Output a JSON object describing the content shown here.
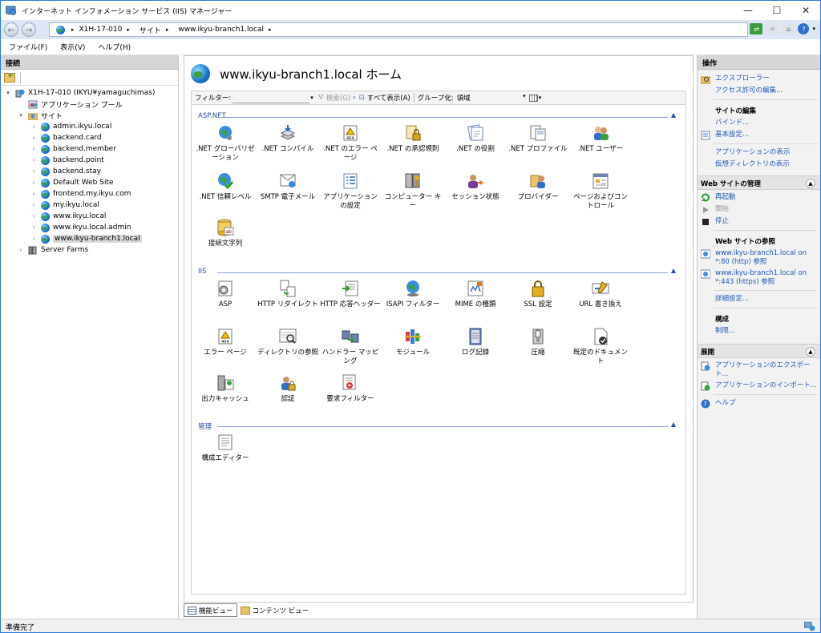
{
  "window": {
    "title": "インターネット インフォメーション サービス (IIS) マネージャー",
    "min": "—",
    "max": "☐",
    "close": "✕"
  },
  "address": {
    "crumbs": [
      "X1H-17-010",
      "サイト",
      "www.ikyu-branch1.local"
    ]
  },
  "menu": [
    "ファイル(F)",
    "表示(V)",
    "ヘルプ(H)"
  ],
  "left": {
    "header": "接続",
    "tree": [
      {
        "label": "X1H-17-010 (IKYU¥yamaguchimas)",
        "level": 0,
        "toggle": "▾",
        "icon": "server-icon"
      },
      {
        "label": "アプリケーション プール",
        "level": 1,
        "toggle": "",
        "icon": "app-pool-icon"
      },
      {
        "label": "サイト",
        "level": 1,
        "toggle": "▾",
        "icon": "sites-folder-icon"
      },
      {
        "label": "admin.ikyu.local",
        "level": 2,
        "toggle": "›",
        "icon": "globe-icon"
      },
      {
        "label": "backend.card",
        "level": 2,
        "toggle": "›",
        "icon": "globe-icon"
      },
      {
        "label": "backend.member",
        "level": 2,
        "toggle": "›",
        "icon": "globe-icon"
      },
      {
        "label": "backend.point",
        "level": 2,
        "toggle": "›",
        "icon": "globe-icon"
      },
      {
        "label": "backend.stay",
        "level": 2,
        "toggle": "›",
        "icon": "globe-icon"
      },
      {
        "label": "Default Web Site",
        "level": 2,
        "toggle": "›",
        "icon": "globe-icon"
      },
      {
        "label": "frontend.my.ikyu.com",
        "level": 2,
        "toggle": "›",
        "icon": "globe-icon"
      },
      {
        "label": "my.ikyu.local",
        "level": 2,
        "toggle": "›",
        "icon": "globe-icon"
      },
      {
        "label": "www.ikyu.local",
        "level": 2,
        "toggle": "›",
        "icon": "globe-icon"
      },
      {
        "label": "www.ikyu.local.admin",
        "level": 2,
        "toggle": "›",
        "icon": "globe-icon"
      },
      {
        "label": "www.ikyu-branch1.local",
        "level": 2,
        "toggle": "›",
        "icon": "globe-icon",
        "selected": true
      },
      {
        "label": "Server Farms",
        "level": 1,
        "toggle": "›",
        "icon": "server-farms-icon"
      }
    ]
  },
  "center": {
    "title": "www.ikyu-branch1.local ホーム",
    "filter": {
      "label": "フィルター:",
      "search": "検索(G)",
      "show_all": "すべて表示(A)",
      "group_label": "グループ化:",
      "group_value": "領域"
    },
    "sections": [
      {
        "name": "ASP.NET",
        "items": [
          {
            "label": ".NET グローバリゼーション",
            "icon": "globe-gear-icon"
          },
          {
            "label": ".NET コンパイル",
            "icon": "compile-icon"
          },
          {
            "label": ".NET のエラー ページ",
            "icon": "error-page-icon"
          },
          {
            "label": ".NET の承認規則",
            "icon": "authorization-lock-icon"
          },
          {
            "label": ".NET の役割",
            "icon": "roles-icon"
          },
          {
            "label": ".NET プロファイル",
            "icon": "profile-icon"
          },
          {
            "label": ".NET ユーザー",
            "icon": "users-icon"
          },
          {
            "label": ".NET 信頼レベル",
            "icon": "trust-level-icon"
          },
          {
            "label": "SMTP 電子メール",
            "icon": "smtp-mail-icon"
          },
          {
            "label": "アプリケーションの設定",
            "icon": "app-settings-icon"
          },
          {
            "label": "コンピューター キー",
            "icon": "machine-key-icon"
          },
          {
            "label": "セッション状態",
            "icon": "session-state-icon"
          },
          {
            "label": "プロバイダー",
            "icon": "providers-icon"
          },
          {
            "label": "ページおよびコントロール",
            "icon": "pages-controls-icon"
          },
          {
            "label": "接続文字列",
            "icon": "connection-strings-icon"
          }
        ]
      },
      {
        "name": "IIS",
        "items": [
          {
            "label": "ASP",
            "icon": "asp-icon"
          },
          {
            "label": "HTTP リダイレクト",
            "icon": "http-redirect-icon"
          },
          {
            "label": "HTTP 応答ヘッダー",
            "icon": "response-headers-icon"
          },
          {
            "label": "ISAPI フィルター",
            "icon": "isapi-filter-icon"
          },
          {
            "label": "MIME の種類",
            "icon": "mime-types-icon"
          },
          {
            "label": "SSL 設定",
            "icon": "ssl-lock-icon"
          },
          {
            "label": "URL 書き換え",
            "icon": "url-rewrite-icon"
          },
          {
            "label": "エラー ページ",
            "icon": "error-pages-icon"
          },
          {
            "label": "ディレクトリの参照",
            "icon": "directory-browsing-icon"
          },
          {
            "label": "ハンドラー マッピング",
            "icon": "handler-mappings-icon"
          },
          {
            "label": "モジュール",
            "icon": "modules-icon"
          },
          {
            "label": "ログ記録",
            "icon": "logging-icon"
          },
          {
            "label": "圧縮",
            "icon": "compression-icon"
          },
          {
            "label": "既定のドキュメント",
            "icon": "default-document-icon"
          },
          {
            "label": "出力キャッシュ",
            "icon": "output-cache-icon"
          },
          {
            "label": "認証",
            "icon": "authentication-icon"
          },
          {
            "label": "要求フィルター",
            "icon": "request-filtering-icon"
          }
        ]
      },
      {
        "name": "管理",
        "items": [
          {
            "label": "構成エディター",
            "icon": "configuration-editor-icon"
          }
        ]
      }
    ]
  },
  "right": {
    "header": "操作",
    "top_actions": [
      {
        "label": "エクスプローラー",
        "icon": "explore-icon"
      },
      {
        "label": "アクセス許可の編集...",
        "icon": ""
      }
    ],
    "edit_site": {
      "heading": "サイトの編集",
      "actions": [
        {
          "label": "バインド...",
          "icon": ""
        },
        {
          "label": "基本設定...",
          "icon": "basic-settings-icon"
        },
        {
          "label": "アプリケーションの表示",
          "icon": ""
        },
        {
          "label": "仮想ディレクトリの表示",
          "icon": ""
        }
      ]
    },
    "manage": {
      "header": "Web サイトの管理",
      "actions": [
        {
          "label": "再起動",
          "icon": "restart-icon",
          "disabled": false
        },
        {
          "label": "開始",
          "icon": "start-icon",
          "disabled": true
        },
        {
          "label": "停止",
          "icon": "stop-icon",
          "disabled": false
        }
      ]
    },
    "browse": {
      "heading": "Web サイトの参照",
      "actions": [
        {
          "label": "www.ikyu-branch1.local on *:80 (http) 参照",
          "icon": "browse-icon"
        },
        {
          "label": "www.ikyu-branch1.local on *:443 (https) 参照",
          "icon": "browse-icon"
        }
      ],
      "advanced": "詳細設定..."
    },
    "config": {
      "heading": "構成",
      "limits": "制限..."
    },
    "deploy": {
      "header": "展開",
      "actions": [
        {
          "label": "アプリケーションのエクスポート...",
          "icon": "export-icon"
        },
        {
          "label": "アプリケーションのインポート...",
          "icon": "import-icon"
        }
      ]
    },
    "help": {
      "label": "ヘルプ",
      "icon": "help-icon"
    }
  },
  "tabs": {
    "features": "機能ビュー",
    "content": "コンテンツ ビュー"
  },
  "status": "準備完了"
}
